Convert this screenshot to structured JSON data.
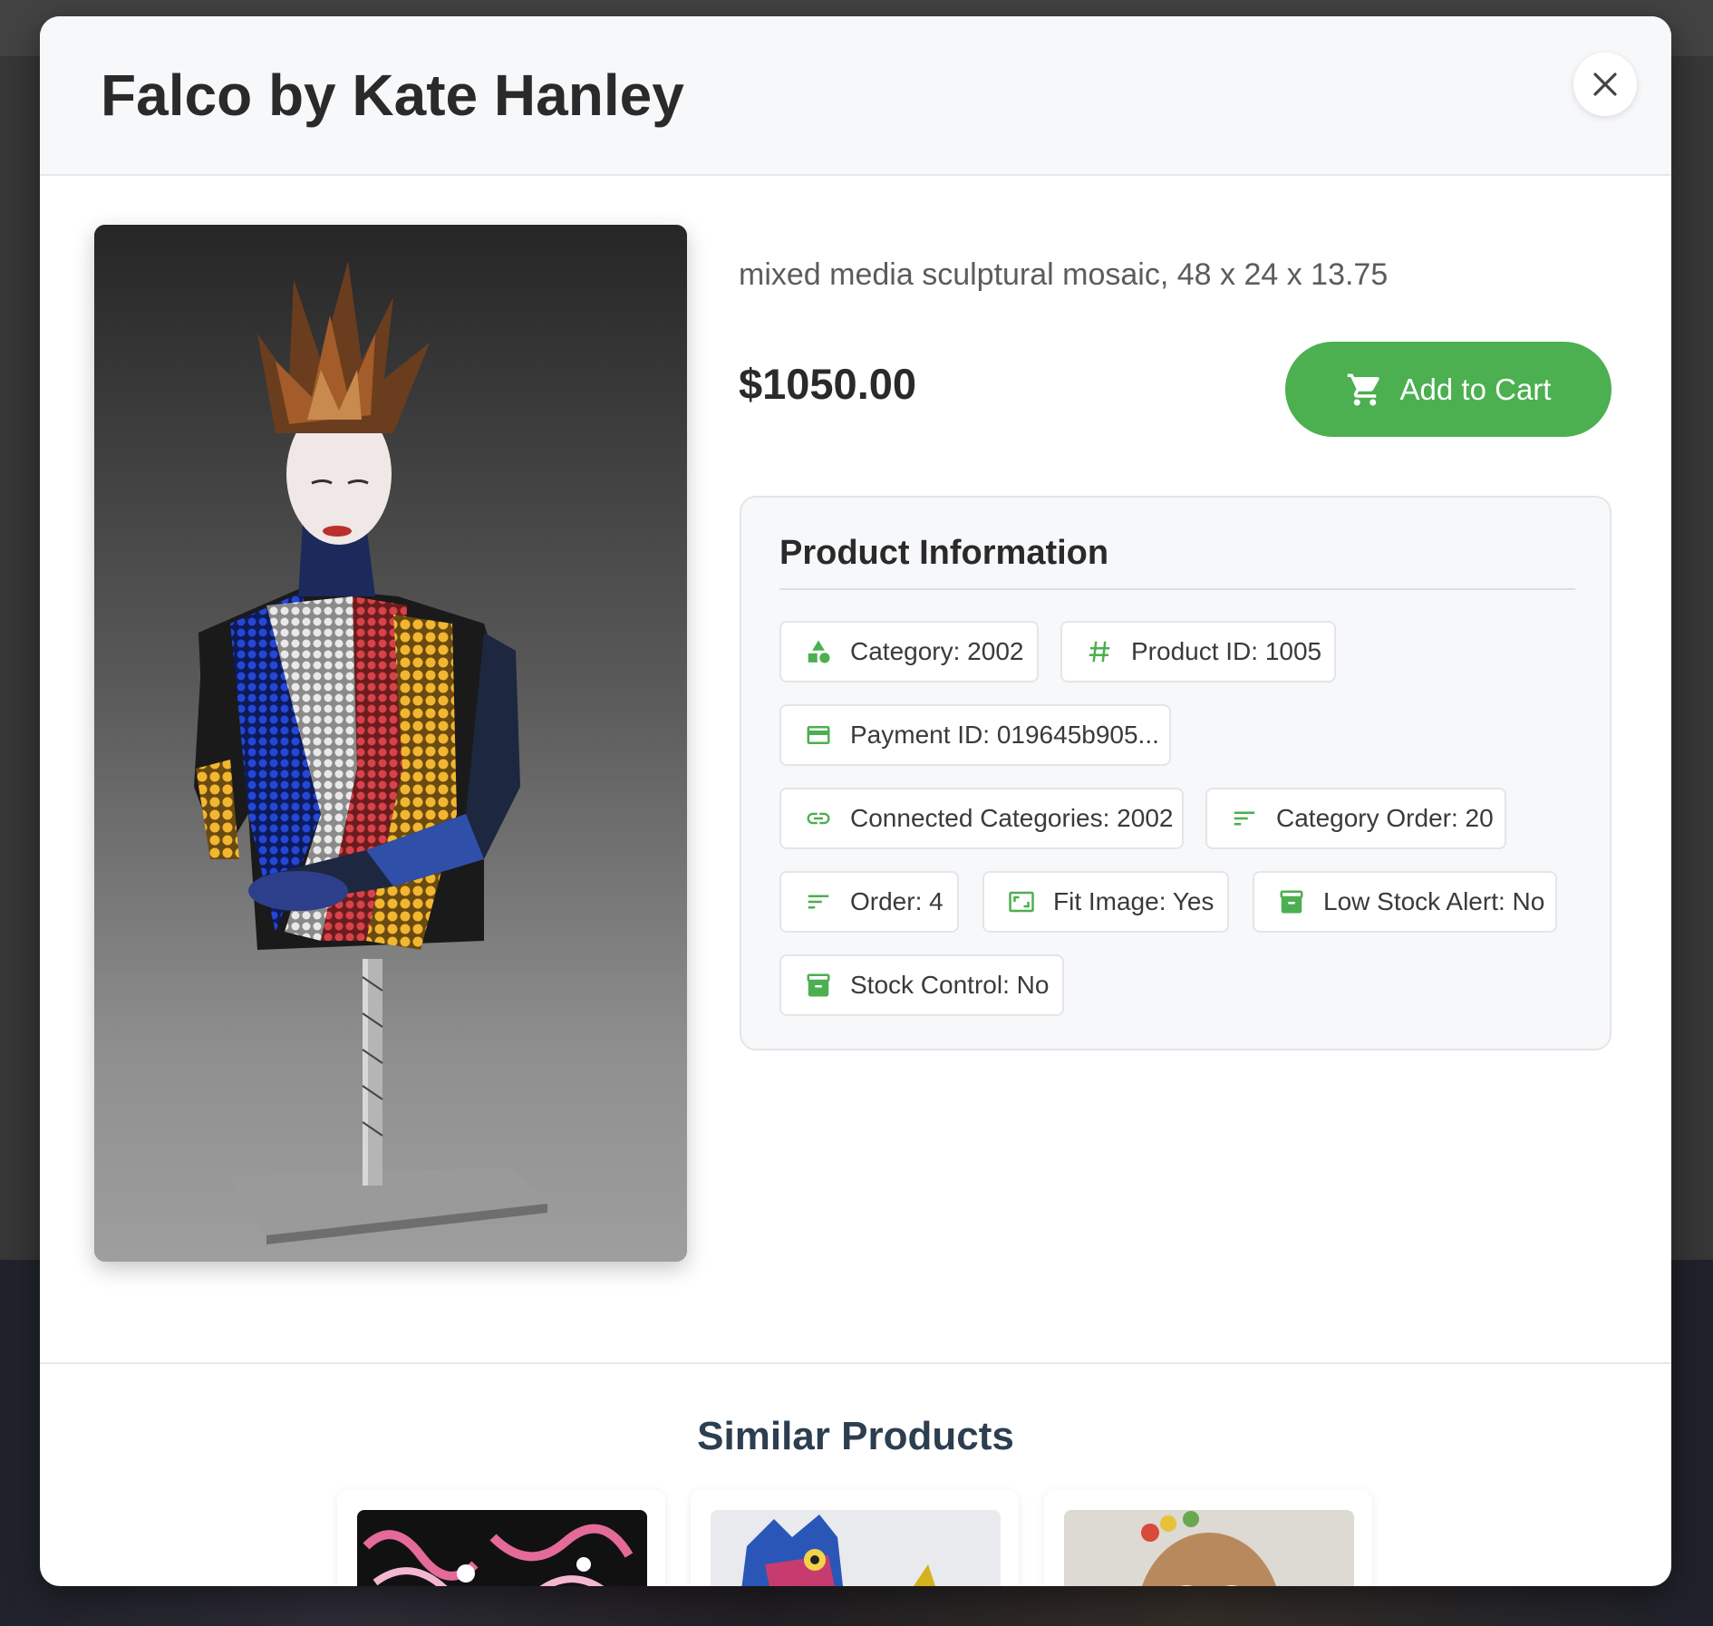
{
  "modal": {
    "title": "Falco by Kate Hanley",
    "close_icon": "close-icon"
  },
  "product": {
    "description": "mixed media sculptural mosaic, 48 x 24 x 13.75",
    "price": "$1050.00",
    "add_to_cart_label": "Add to Cart",
    "cart_icon": "cart-icon"
  },
  "info": {
    "title": "Product Information",
    "chips": [
      {
        "icon": "category-shapes-icon",
        "label": "Category: 2002"
      },
      {
        "icon": "hash-icon",
        "label": "Product ID: 1005"
      },
      {
        "icon": "credit-card-icon",
        "label": "Payment ID: 019645b905..."
      },
      {
        "icon": "link-icon",
        "label": "Connected Categories: 2002"
      },
      {
        "icon": "sort-icon",
        "label": "Category Order: 20"
      },
      {
        "icon": "sort-icon",
        "label": "Order: 4"
      },
      {
        "icon": "aspect-ratio-icon",
        "label": "Fit Image: Yes"
      },
      {
        "icon": "archive-icon",
        "label": "Low Stock Alert: No"
      },
      {
        "icon": "archive-icon",
        "label": "Stock Control: No"
      }
    ]
  },
  "similar": {
    "title": "Similar Products"
  },
  "colors": {
    "accent": "#4caf50",
    "title_dark": "#2c3e50"
  }
}
